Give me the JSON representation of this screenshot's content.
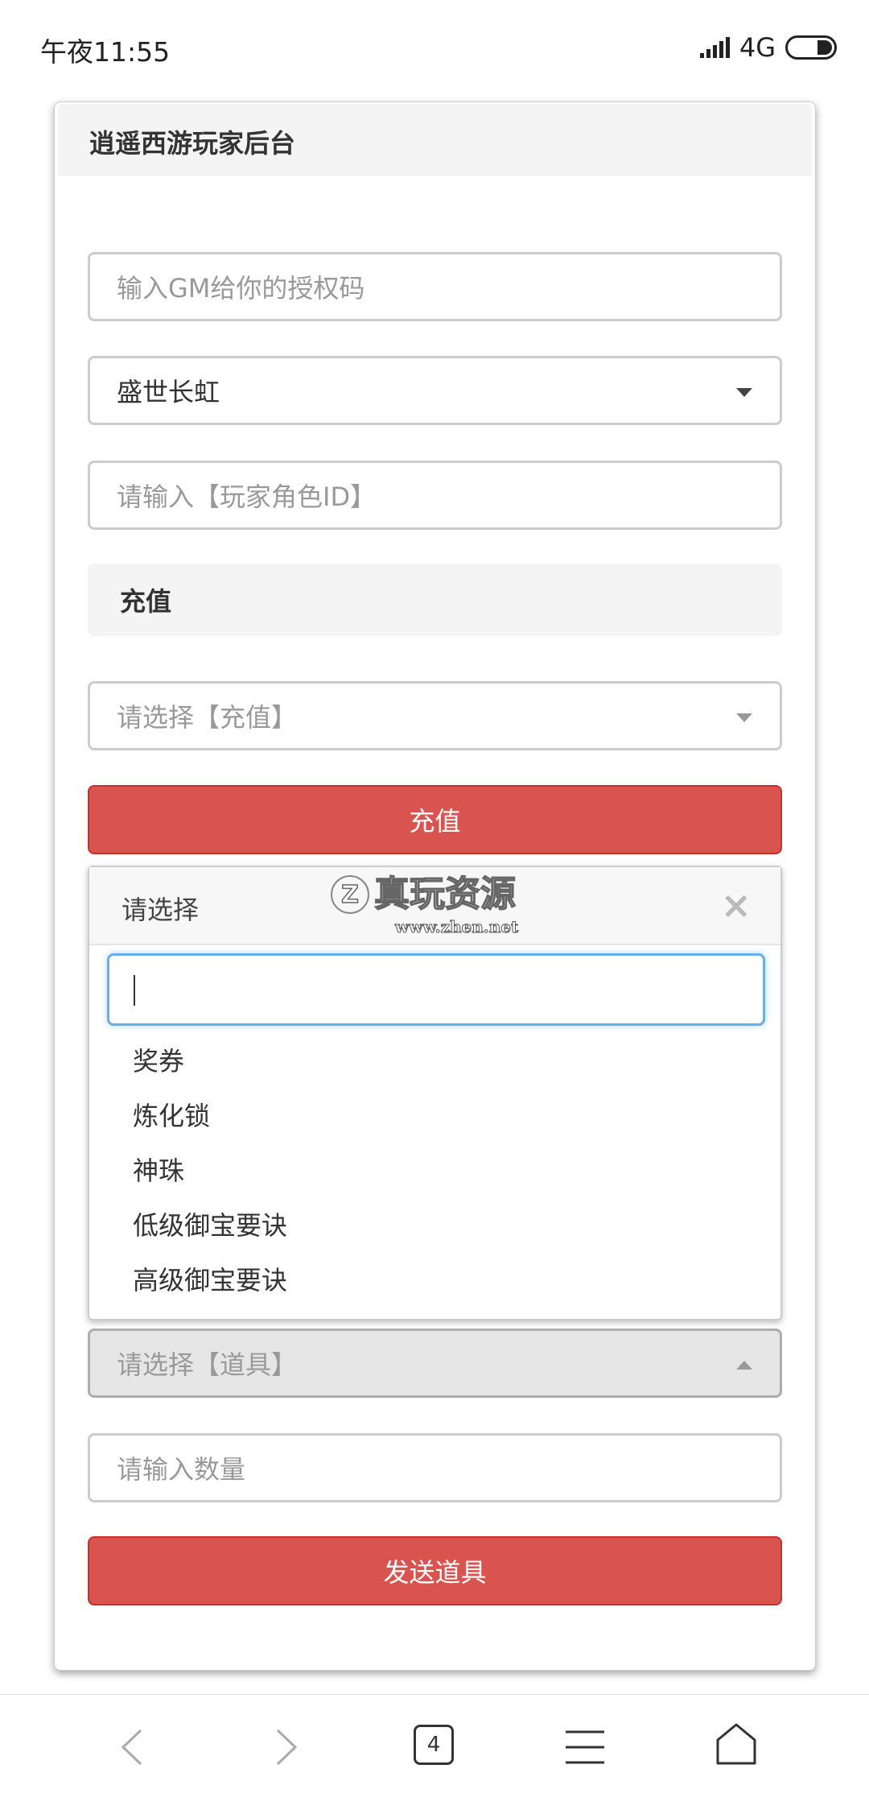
{
  "status_bar": {
    "time": "午夜11:55",
    "network": "4G"
  },
  "card": {
    "title": "逍遥西游玩家后台"
  },
  "form": {
    "auth_placeholder": "输入GM给你的授权码",
    "server_value": "盛世长虹",
    "role_placeholder": "请输入【玩家角色ID】",
    "recharge_section": "充值",
    "recharge_placeholder": "请选择【充值】",
    "recharge_button": "充值",
    "item_placeholder": "请选择【道具】",
    "qty_placeholder": "请输入数量",
    "send_button": "发送道具"
  },
  "dropdown": {
    "title": "请选择",
    "close": "×",
    "search_value": "",
    "options": [
      "奖券",
      "炼化锁",
      "神珠",
      "低级御宝要诀",
      "高级御宝要诀"
    ]
  },
  "watermark": {
    "text": "真玩资源",
    "url": "www.zhen.net"
  },
  "browser_nav": {
    "tabs_count": "4"
  },
  "colors": {
    "accent": "#d9534f",
    "focus": "#66afe9"
  }
}
